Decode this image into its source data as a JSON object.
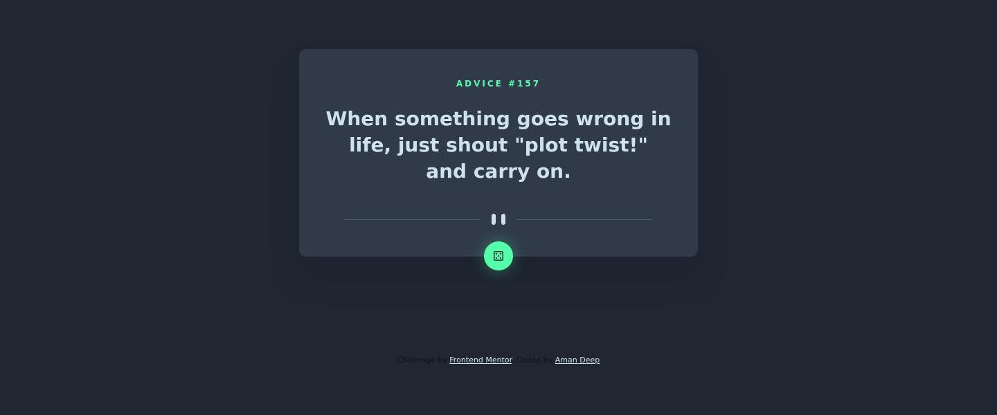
{
  "card": {
    "advice_label": "ADVICE #157",
    "quote": "When something goes wrong in life, just shout \"plot twist!\" and carry on."
  },
  "divider": {
    "icon": "pause-icon"
  },
  "button": {
    "icon": "dice-icon",
    "color": "#53ffaa"
  },
  "footer": {
    "challenge_text": "Challenge by",
    "challenge_link": "Frontend Mentor",
    "separator": ".",
    "coded_text": "Coded by",
    "coded_link": "Aman Deep"
  },
  "colors": {
    "background": "#202733",
    "card": "#313a48",
    "accent": "#53ffaa",
    "text": "#cee3e9"
  }
}
